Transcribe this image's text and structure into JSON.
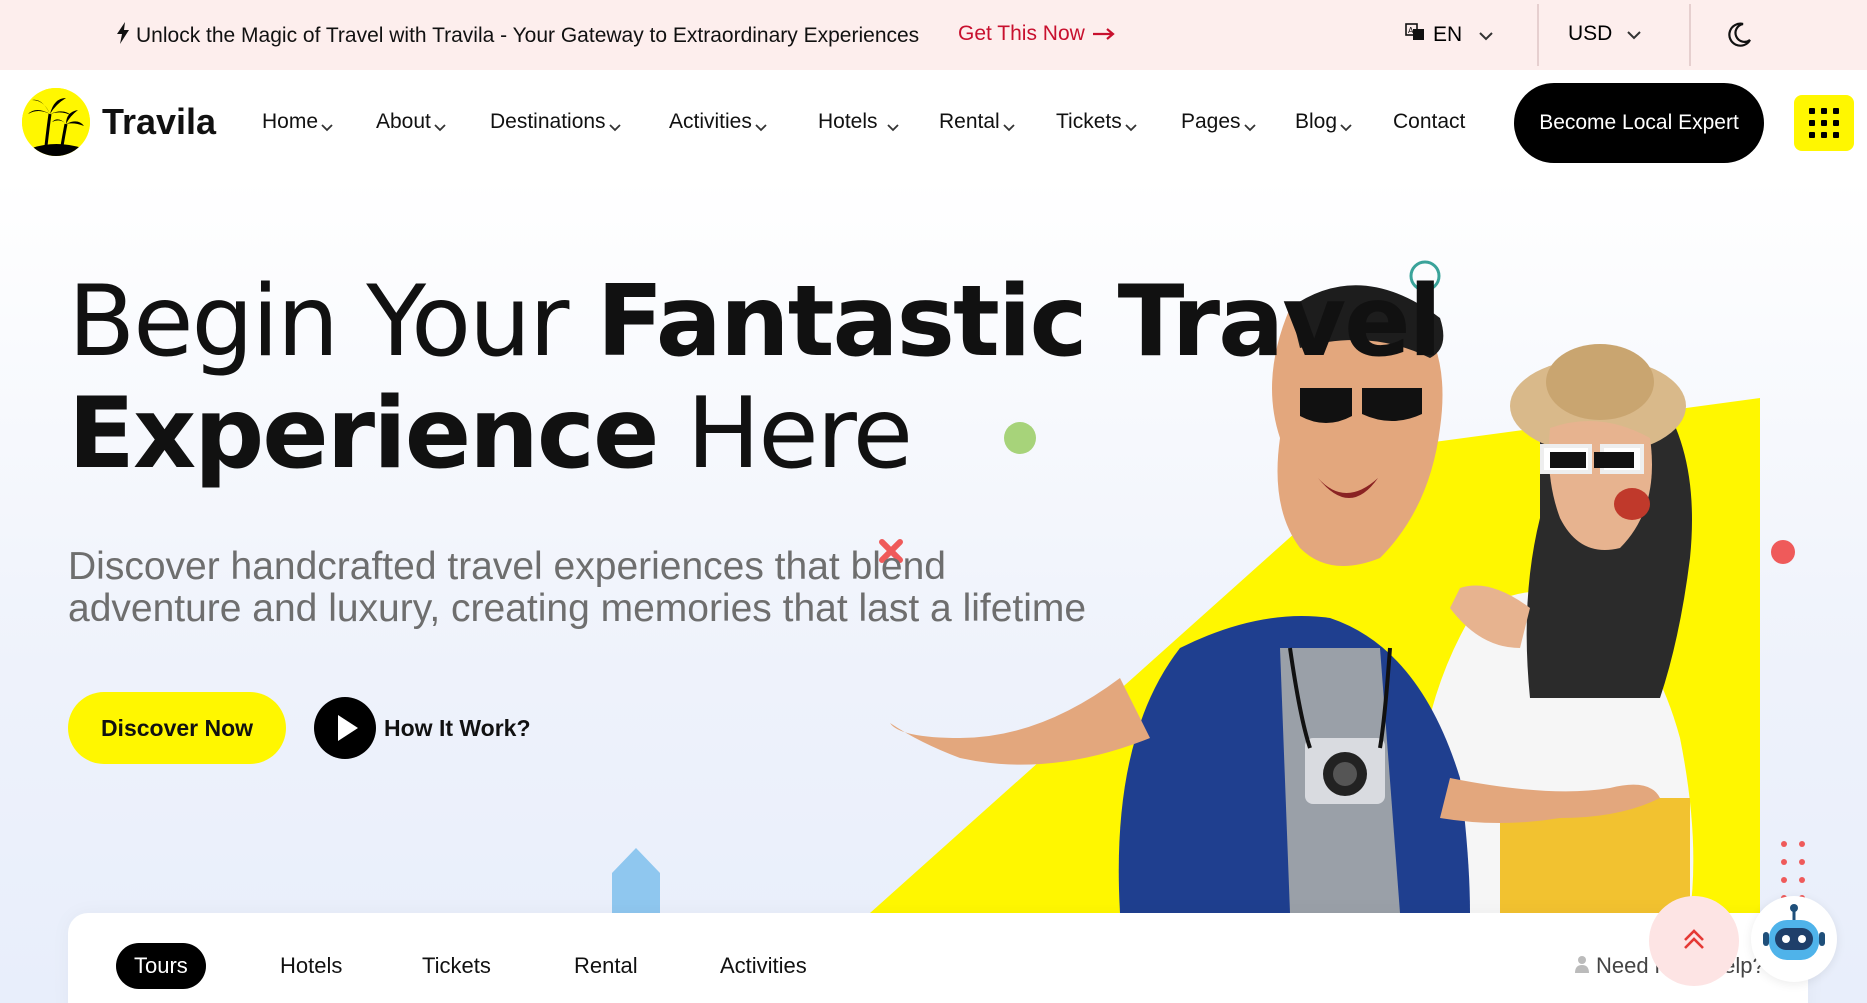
{
  "topbar": {
    "promo_text": "Unlock the Magic of Travel with Travila - Your Gateway to Extraordinary Experiences",
    "promo_link": "Get This Now",
    "language": "EN",
    "currency": "USD"
  },
  "header": {
    "brand": "Travila",
    "nav": [
      {
        "label": "Home",
        "has_menu": true
      },
      {
        "label": "About",
        "has_menu": true
      },
      {
        "label": "Destinations",
        "has_menu": true
      },
      {
        "label": "Activities",
        "has_menu": true
      },
      {
        "label": "Hotels",
        "has_menu": true
      },
      {
        "label": "Rental",
        "has_menu": true
      },
      {
        "label": "Tickets",
        "has_menu": true
      },
      {
        "label": "Pages",
        "has_menu": true
      },
      {
        "label": "Blog",
        "has_menu": true
      },
      {
        "label": "Contact",
        "has_menu": false
      }
    ],
    "cta_label": "Become Local Expert"
  },
  "hero": {
    "title_light_1": "Begin Your ",
    "title_bold_1": "Fantastic Travel",
    "title_bold_2": "Experience",
    "title_light_2": " Here",
    "subtitle": "Discover handcrafted travel experiences that blend adventure and luxury, creating memories that last a lifetime",
    "primary_button": "Discover Now",
    "secondary_button": "How It Work?"
  },
  "search": {
    "tabs": [
      "Tours",
      "Hotels",
      "Tickets",
      "Rental",
      "Activities"
    ],
    "active_tab": "Tours",
    "help_text": "Need more help?"
  },
  "colors": {
    "accent_yellow": "#fff700",
    "promo_red": "#c8102e",
    "topbar_bg": "#fdeeed"
  }
}
